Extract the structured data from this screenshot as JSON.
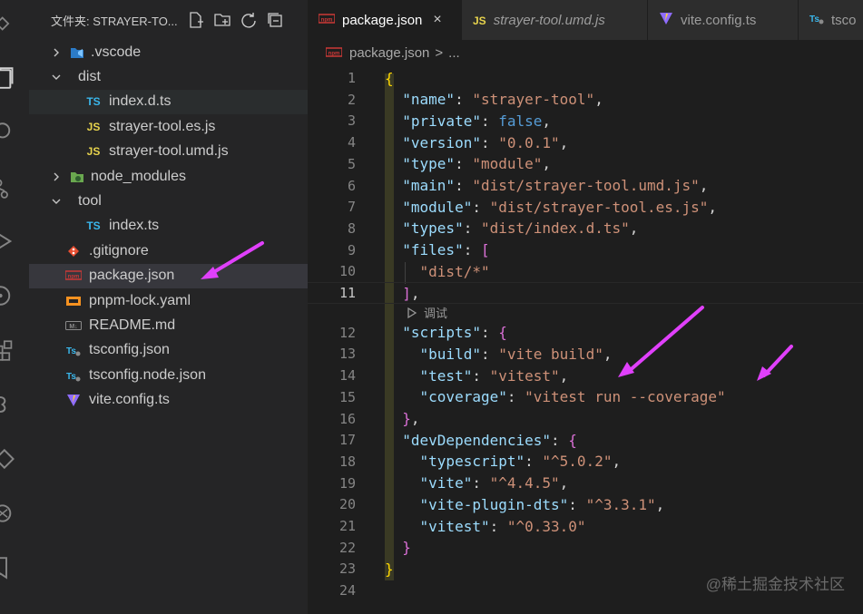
{
  "activity_bar": {
    "items": [
      "explorer-icon",
      "files-icon",
      "search-icon",
      "source-control-icon",
      "run-debug-icon",
      "git-graph-icon",
      "extensions-icon",
      "remote-icon",
      "test-icon",
      "openai-icon",
      "bookmark-icon"
    ]
  },
  "sidebar": {
    "title": "文件夹: STRAYER-TO...",
    "actions": [
      "new-file-icon",
      "new-folder-icon",
      "refresh-icon",
      "collapse-all-icon"
    ],
    "items": [
      {
        "label": ".vscode",
        "type": "folder",
        "expanded": false,
        "depth": 0
      },
      {
        "label": "dist",
        "type": "folder",
        "expanded": true,
        "depth": 0
      },
      {
        "label": "index.d.ts",
        "type": "ts",
        "depth": 1
      },
      {
        "label": "strayer-tool.es.js",
        "type": "js",
        "depth": 1
      },
      {
        "label": "strayer-tool.umd.js",
        "type": "js",
        "depth": 1
      },
      {
        "label": "node_modules",
        "type": "folder",
        "expanded": false,
        "depth": 0
      },
      {
        "label": "tool",
        "type": "folder",
        "expanded": true,
        "depth": 0
      },
      {
        "label": "index.ts",
        "type": "ts",
        "depth": 1
      },
      {
        "label": ".gitignore",
        "type": "git",
        "depth": 0
      },
      {
        "label": "package.json",
        "type": "npm",
        "depth": 0,
        "selected": true
      },
      {
        "label": "pnpm-lock.yaml",
        "type": "yaml",
        "depth": 0
      },
      {
        "label": "README.md",
        "type": "md",
        "depth": 0
      },
      {
        "label": "tsconfig.json",
        "type": "tsconfig",
        "depth": 0
      },
      {
        "label": "tsconfig.node.json",
        "type": "tsconfig",
        "depth": 0
      },
      {
        "label": "vite.config.ts",
        "type": "vite",
        "depth": 0
      }
    ]
  },
  "tabs": [
    {
      "label": "package.json",
      "icon": "npm",
      "active": true,
      "close": "×"
    },
    {
      "label": "strayer-tool.umd.js",
      "icon": "js",
      "active": false,
      "italic": true
    },
    {
      "label": "vite.config.ts",
      "icon": "vite",
      "active": false
    },
    {
      "label": "tsco",
      "icon": "tsconfig",
      "active": false
    }
  ],
  "badges": {
    "ts": "TS",
    "js": "JS"
  },
  "breadcrumb": {
    "file": "package.json",
    "sep": ">",
    "more": "..."
  },
  "editor": {
    "current_line": 11,
    "codelens": "调试",
    "lines": [
      {
        "n": "1",
        "tokens": [
          [
            "{",
            "b1"
          ]
        ]
      },
      {
        "n": "2",
        "tokens": [
          [
            "  ",
            "p"
          ],
          [
            "\"name\"",
            "k"
          ],
          [
            ": ",
            "p"
          ],
          [
            "\"strayer-tool\"",
            "s"
          ],
          [
            ",",
            "p"
          ]
        ]
      },
      {
        "n": "3",
        "tokens": [
          [
            "  ",
            "p"
          ],
          [
            "\"private\"",
            "k"
          ],
          [
            ": ",
            "p"
          ],
          [
            "false",
            "bool"
          ],
          [
            ",",
            "p"
          ]
        ]
      },
      {
        "n": "4",
        "tokens": [
          [
            "  ",
            "p"
          ],
          [
            "\"version\"",
            "k"
          ],
          [
            ": ",
            "p"
          ],
          [
            "\"0.0.1\"",
            "s"
          ],
          [
            ",",
            "p"
          ]
        ]
      },
      {
        "n": "5",
        "tokens": [
          [
            "  ",
            "p"
          ],
          [
            "\"type\"",
            "k"
          ],
          [
            ": ",
            "p"
          ],
          [
            "\"module\"",
            "s"
          ],
          [
            ",",
            "p"
          ]
        ]
      },
      {
        "n": "6",
        "tokens": [
          [
            "  ",
            "p"
          ],
          [
            "\"main\"",
            "k"
          ],
          [
            ": ",
            "p"
          ],
          [
            "\"dist/strayer-tool.umd.js\"",
            "s"
          ],
          [
            ",",
            "p"
          ]
        ]
      },
      {
        "n": "7",
        "tokens": [
          [
            "  ",
            "p"
          ],
          [
            "\"module\"",
            "k"
          ],
          [
            ": ",
            "p"
          ],
          [
            "\"dist/strayer-tool.es.js\"",
            "s"
          ],
          [
            ",",
            "p"
          ]
        ]
      },
      {
        "n": "8",
        "tokens": [
          [
            "  ",
            "p"
          ],
          [
            "\"types\"",
            "k"
          ],
          [
            ": ",
            "p"
          ],
          [
            "\"dist/index.d.ts\"",
            "s"
          ],
          [
            ",",
            "p"
          ]
        ]
      },
      {
        "n": "9",
        "tokens": [
          [
            "  ",
            "p"
          ],
          [
            "\"files\"",
            "k"
          ],
          [
            ": ",
            "p"
          ],
          [
            "[",
            "b2"
          ]
        ]
      },
      {
        "n": "10",
        "tokens": [
          [
            "    ",
            "p"
          ],
          [
            "\"dist/*\"",
            "s"
          ]
        ]
      },
      {
        "n": "11",
        "tokens": [
          [
            "  ",
            "p"
          ],
          [
            "]",
            "b2"
          ],
          [
            ",",
            "p"
          ]
        ]
      },
      {
        "n": "12",
        "tokens": [
          [
            "  ",
            "p"
          ],
          [
            "\"scripts\"",
            "k"
          ],
          [
            ": ",
            "p"
          ],
          [
            "{",
            "b2"
          ]
        ]
      },
      {
        "n": "13",
        "tokens": [
          [
            "    ",
            "p"
          ],
          [
            "\"build\"",
            "k"
          ],
          [
            ": ",
            "p"
          ],
          [
            "\"vite build\"",
            "s"
          ],
          [
            ",",
            "p"
          ]
        ]
      },
      {
        "n": "14",
        "tokens": [
          [
            "    ",
            "p"
          ],
          [
            "\"test\"",
            "k"
          ],
          [
            ": ",
            "p"
          ],
          [
            "\"vitest\"",
            "s"
          ],
          [
            ",",
            "p"
          ]
        ]
      },
      {
        "n": "15",
        "tokens": [
          [
            "    ",
            "p"
          ],
          [
            "\"coverage\"",
            "k"
          ],
          [
            ": ",
            "p"
          ],
          [
            "\"vitest run --coverage\"",
            "s"
          ]
        ]
      },
      {
        "n": "16",
        "tokens": [
          [
            "  ",
            "p"
          ],
          [
            "}",
            "b2"
          ],
          [
            ",",
            "p"
          ]
        ]
      },
      {
        "n": "17",
        "tokens": [
          [
            "  ",
            "p"
          ],
          [
            "\"devDependencies\"",
            "k"
          ],
          [
            ": ",
            "p"
          ],
          [
            "{",
            "b2"
          ]
        ]
      },
      {
        "n": "18",
        "tokens": [
          [
            "    ",
            "p"
          ],
          [
            "\"typescript\"",
            "k"
          ],
          [
            ": ",
            "p"
          ],
          [
            "\"^5.0.2\"",
            "s"
          ],
          [
            ",",
            "p"
          ]
        ]
      },
      {
        "n": "19",
        "tokens": [
          [
            "    ",
            "p"
          ],
          [
            "\"vite\"",
            "k"
          ],
          [
            ": ",
            "p"
          ],
          [
            "\"^4.4.5\"",
            "s"
          ],
          [
            ",",
            "p"
          ]
        ]
      },
      {
        "n": "20",
        "tokens": [
          [
            "    ",
            "p"
          ],
          [
            "\"vite-plugin-dts\"",
            "k"
          ],
          [
            ": ",
            "p"
          ],
          [
            "\"^3.3.1\"",
            "s"
          ],
          [
            ",",
            "p"
          ]
        ]
      },
      {
        "n": "21",
        "tokens": [
          [
            "    ",
            "p"
          ],
          [
            "\"vitest\"",
            "k"
          ],
          [
            ": ",
            "p"
          ],
          [
            "\"^0.33.0\"",
            "s"
          ]
        ]
      },
      {
        "n": "22",
        "tokens": [
          [
            "  ",
            "p"
          ],
          [
            "}",
            "b2"
          ]
        ]
      },
      {
        "n": "23",
        "tokens": [
          [
            "}",
            "b1"
          ]
        ]
      },
      {
        "n": "24",
        "tokens": []
      }
    ]
  },
  "watermark": "@稀土掘金技术社区",
  "colors": {
    "annotation_arrow": "#e040fb",
    "selected_row": "#37373d",
    "string": "#ce9178",
    "key": "#9cdcfe"
  }
}
